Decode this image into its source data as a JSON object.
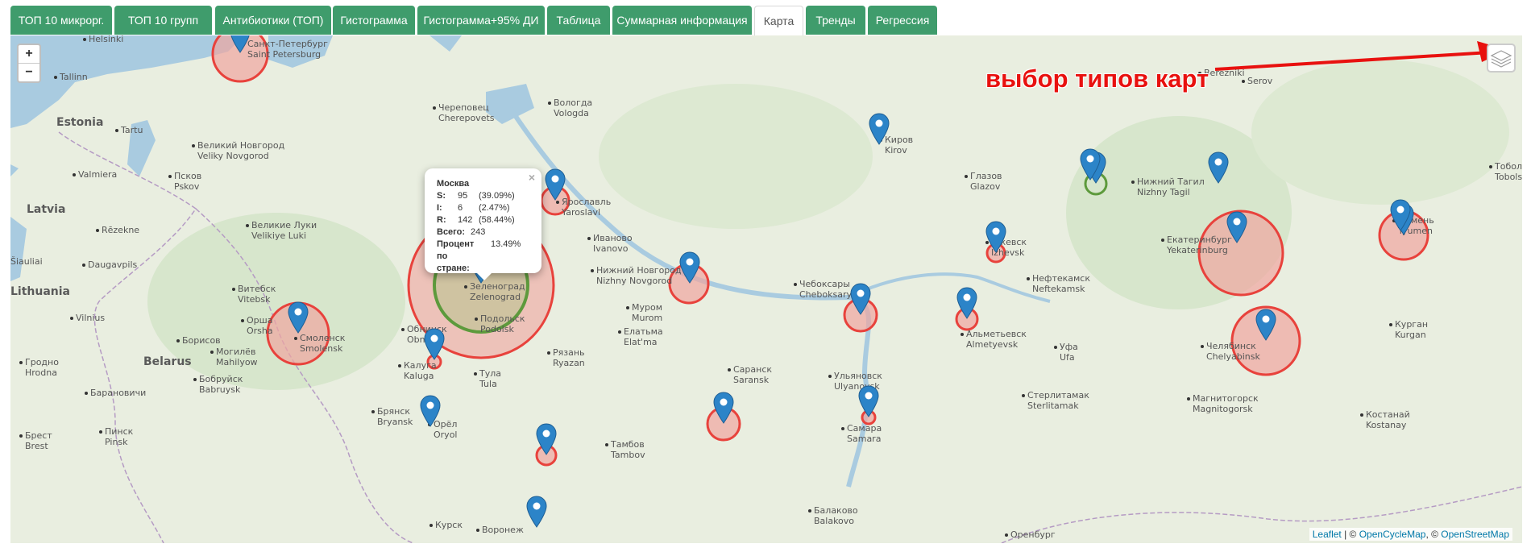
{
  "tabs": [
    {
      "label": "ТОП 10 микрорг.",
      "active": false
    },
    {
      "label": "ТОП 10 групп",
      "active": false
    },
    {
      "label": "Антибиотики (ТОП)",
      "active": false
    },
    {
      "label": "Гистограмма",
      "active": false
    },
    {
      "label": "Гистограмма+95% ДИ",
      "active": false
    },
    {
      "label": "Таблица",
      "active": false
    },
    {
      "label": "Суммарная информация",
      "active": false
    },
    {
      "label": "Карта",
      "active": true
    },
    {
      "label": "Тренды",
      "active": false
    },
    {
      "label": "Регрессия",
      "active": false
    }
  ],
  "map": {
    "zoom_in": "+",
    "zoom_out": "−",
    "layers_icon": "layers-icon",
    "annotation": "выбор типов карт",
    "countries": [
      {
        "name": "Estonia"
      },
      {
        "name": "Latvia"
      },
      {
        "name": "Lithuania"
      },
      {
        "name": "Belarus"
      }
    ],
    "cities": [
      {
        "text": "Helsinki"
      },
      {
        "text": "Tallinn"
      },
      {
        "text": "Tartu"
      },
      {
        "text": "Valmiera"
      },
      {
        "text": "Rēzekne"
      },
      {
        "text": "Šiauliai"
      },
      {
        "text": "Daugavpils"
      },
      {
        "text": "Vilnius"
      },
      {
        "text": "Гродно\nHrodna"
      },
      {
        "text": "Брест\nBrest"
      },
      {
        "text": "Пинск\nPinsk"
      },
      {
        "text": "Барановичи"
      },
      {
        "text": "Бобруйск\nBabruysk"
      },
      {
        "text": "Могилёв\nMahilyow"
      },
      {
        "text": "Борисов"
      },
      {
        "text": "Витебск\nVitebsk"
      },
      {
        "text": "Орша\nOrsha"
      },
      {
        "text": "Великий Новгород\nVeliky Novgorod"
      },
      {
        "text": "Псков\nPskov"
      },
      {
        "text": "Великие Луки\nVelikiye Luki"
      },
      {
        "text": "Санкт-Петербург\nSaint Petersburg"
      },
      {
        "text": "Череповец\nCherepovets"
      },
      {
        "text": "Вологда\nVologda"
      },
      {
        "text": "Ярославль\nYaroslavl"
      },
      {
        "text": "Иваново\nIvanovo"
      },
      {
        "text": "Нижний Новгород\nNizhny Novgorod"
      },
      {
        "text": "Муром\nMurom"
      },
      {
        "text": "Елатьма\nElat'ma"
      },
      {
        "text": "Рязань\nRyazan"
      },
      {
        "text": "Тула\nTula"
      },
      {
        "text": "Калуга\nKaluga"
      },
      {
        "text": "Обнинск\nObninsk"
      },
      {
        "text": "Смоленск\nSmolensk"
      },
      {
        "text": "Зеленоград\nZelenograd"
      },
      {
        "text": "Подольск\nPodolsk"
      },
      {
        "text": "Брянск\nBryansk"
      },
      {
        "text": "Орёл\nOryol"
      },
      {
        "text": "Курск"
      },
      {
        "text": "Воронеж"
      },
      {
        "text": "Тамбов\nTambov"
      },
      {
        "text": "Саранск\nSaransk"
      },
      {
        "text": "Ульяновск\nUlyanovsk"
      },
      {
        "text": "Самара\nSamara"
      },
      {
        "text": "Балаково\nBalakovo"
      },
      {
        "text": "Чебоксары\nCheboksary"
      },
      {
        "text": "Киров\nKirov"
      },
      {
        "text": "Глазов\nGlazov"
      },
      {
        "text": "Ижевск\nIzhevsk"
      },
      {
        "text": "Нефтекамск\nNeftekamsk"
      },
      {
        "text": "Альметьевск\nAlmetyevsk"
      },
      {
        "text": "Уфа\nUfa"
      },
      {
        "text": "Стерлитамак\nSterlitamak"
      },
      {
        "text": "Магнитогорск\nMagnitogorsk"
      },
      {
        "text": "Оренбург"
      },
      {
        "text": "Нижний Тагил\nNizhny Tagil"
      },
      {
        "text": "Екатеринбург\nYekaterinburg"
      },
      {
        "text": "Челябинск\nChelyabinsk"
      },
      {
        "text": "Курган\nKurgan"
      },
      {
        "text": "Костанай\nKostanay"
      },
      {
        "text": "Тюмень\nTyumen"
      },
      {
        "text": "Тобольск\nTobolsk"
      },
      {
        "text": "Berezniki"
      },
      {
        "text": "Serov"
      }
    ],
    "popup": {
      "title": "Москва",
      "rows": [
        {
          "k": "S:",
          "n": "95",
          "p": "(39.09%)"
        },
        {
          "k": "I:",
          "n": "6",
          "p": "(2.47%)"
        },
        {
          "k": "R:",
          "n": "142",
          "p": "(58.44%)"
        }
      ],
      "total_label": "Всего:",
      "total": "243",
      "percent_label": "Процент",
      "percent_value": "13.49%",
      "percent_label2": "по",
      "percent_label3": "стране:",
      "close": "×"
    },
    "attribution": {
      "leaflet": "Leaflet",
      "sep1": " | © ",
      "ocm": "OpenCycleMap",
      "sep2": ", © ",
      "osm": "OpenStreetMap"
    },
    "colors": {
      "ring_red": "#e8423c",
      "fill_red": "#f0a59f",
      "ring_green": "#5d9a3c",
      "marker_blue": "#2c84c8"
    }
  }
}
